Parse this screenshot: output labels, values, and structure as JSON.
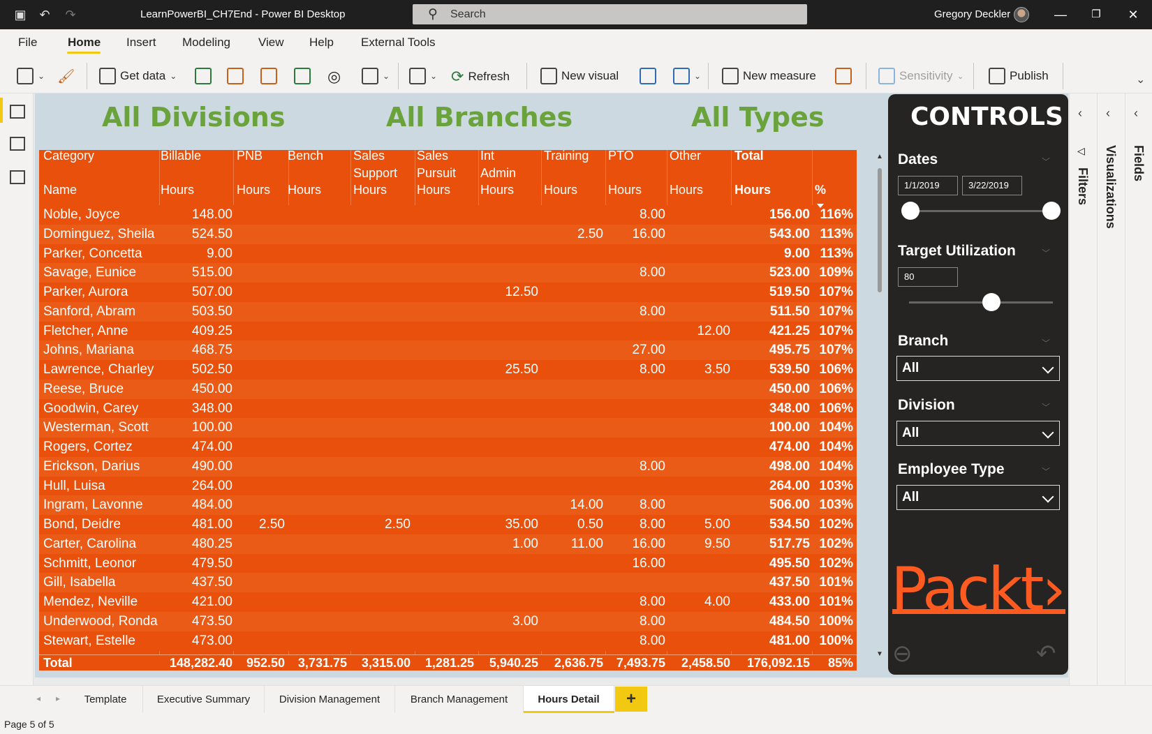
{
  "titlebar": {
    "title": "LearnPowerBI_CH7End - Power BI Desktop",
    "search_placeholder": "Search",
    "user": "Gregory Deckler"
  },
  "menu": [
    "File",
    "Home",
    "Insert",
    "Modeling",
    "View",
    "Help",
    "External Tools"
  ],
  "ribbon": {
    "get_data": "Get data",
    "refresh": "Refresh",
    "new_visual": "New visual",
    "new_measure": "New measure",
    "sensitivity": "Sensitivity",
    "publish": "Publish"
  },
  "titles": {
    "divisions": "All Divisions",
    "branches": "All Branches",
    "types": "All Types"
  },
  "table": {
    "header_top": [
      "Category",
      "Billable",
      "PNB",
      "Bench",
      "Sales\nSupport",
      "Sales\nPursuit",
      "Int\nAdmin",
      "Training",
      "PTO",
      "Other",
      "Total",
      ""
    ],
    "header_bottom": [
      "Name",
      "Hours",
      "Hours",
      "Hours",
      "Hours",
      "Hours",
      "Hours",
      "Hours",
      "Hours",
      "Hours",
      "Hours",
      "%"
    ],
    "rows": [
      [
        "Noble, Joyce",
        "148.00",
        "",
        "",
        "",
        "",
        "",
        "",
        "8.00",
        "",
        "156.00",
        "116%"
      ],
      [
        "Dominguez, Sheila",
        "524.50",
        "",
        "",
        "",
        "",
        "",
        "2.50",
        "16.00",
        "",
        "543.00",
        "113%"
      ],
      [
        "Parker, Concetta",
        "9.00",
        "",
        "",
        "",
        "",
        "",
        "",
        "",
        "",
        "9.00",
        "113%"
      ],
      [
        "Savage, Eunice",
        "515.00",
        "",
        "",
        "",
        "",
        "",
        "",
        "8.00",
        "",
        "523.00",
        "109%"
      ],
      [
        "Parker, Aurora",
        "507.00",
        "",
        "",
        "",
        "",
        "12.50",
        "",
        "",
        "",
        "519.50",
        "107%"
      ],
      [
        "Sanford, Abram",
        "503.50",
        "",
        "",
        "",
        "",
        "",
        "",
        "8.00",
        "",
        "511.50",
        "107%"
      ],
      [
        "Fletcher, Anne",
        "409.25",
        "",
        "",
        "",
        "",
        "",
        "",
        "",
        "12.00",
        "421.25",
        "107%"
      ],
      [
        "Johns, Mariana",
        "468.75",
        "",
        "",
        "",
        "",
        "",
        "",
        "27.00",
        "",
        "495.75",
        "107%"
      ],
      [
        "Lawrence, Charley",
        "502.50",
        "",
        "",
        "",
        "",
        "25.50",
        "",
        "8.00",
        "3.50",
        "539.50",
        "106%"
      ],
      [
        "Reese, Bruce",
        "450.00",
        "",
        "",
        "",
        "",
        "",
        "",
        "",
        "",
        "450.00",
        "106%"
      ],
      [
        "Goodwin, Carey",
        "348.00",
        "",
        "",
        "",
        "",
        "",
        "",
        "",
        "",
        "348.00",
        "106%"
      ],
      [
        "Westerman, Scott",
        "100.00",
        "",
        "",
        "",
        "",
        "",
        "",
        "",
        "",
        "100.00",
        "104%"
      ],
      [
        "Rogers, Cortez",
        "474.00",
        "",
        "",
        "",
        "",
        "",
        "",
        "",
        "",
        "474.00",
        "104%"
      ],
      [
        "Erickson, Darius",
        "490.00",
        "",
        "",
        "",
        "",
        "",
        "",
        "8.00",
        "",
        "498.00",
        "104%"
      ],
      [
        "Hull, Luisa",
        "264.00",
        "",
        "",
        "",
        "",
        "",
        "",
        "",
        "",
        "264.00",
        "103%"
      ],
      [
        "Ingram, Lavonne",
        "484.00",
        "",
        "",
        "",
        "",
        "",
        "14.00",
        "8.00",
        "",
        "506.00",
        "103%"
      ],
      [
        "Bond, Deidre",
        "481.00",
        "2.50",
        "",
        "2.50",
        "",
        "35.00",
        "0.50",
        "8.00",
        "5.00",
        "534.50",
        "102%"
      ],
      [
        "Carter, Carolina",
        "480.25",
        "",
        "",
        "",
        "",
        "1.00",
        "11.00",
        "16.00",
        "9.50",
        "517.75",
        "102%"
      ],
      [
        "Schmitt, Leonor",
        "479.50",
        "",
        "",
        "",
        "",
        "",
        "",
        "16.00",
        "",
        "495.50",
        "102%"
      ],
      [
        "Gill, Isabella",
        "437.50",
        "",
        "",
        "",
        "",
        "",
        "",
        "",
        "",
        "437.50",
        "101%"
      ],
      [
        "Mendez, Neville",
        "421.00",
        "",
        "",
        "",
        "",
        "",
        "",
        "8.00",
        "4.00",
        "433.00",
        "101%"
      ],
      [
        "Underwood, Ronda",
        "473.50",
        "",
        "",
        "",
        "",
        "3.00",
        "",
        "8.00",
        "",
        "484.50",
        "100%"
      ],
      [
        "Stewart, Estelle",
        "473.00",
        "",
        "",
        "",
        "",
        "",
        "",
        "8.00",
        "",
        "481.00",
        "100%"
      ]
    ],
    "total": [
      "Total",
      "148,282.40",
      "952.50",
      "3,731.75",
      "3,315.00",
      "1,281.25",
      "5,940.25",
      "2,636.75",
      "7,493.75",
      "2,458.50",
      "176,092.15",
      "85%"
    ]
  },
  "controls": {
    "title": "CONTROLS",
    "dates_label": "Dates",
    "date_start": "1/1/2019",
    "date_end": "3/22/2019",
    "target_label": "Target Utilization",
    "target_value": "80",
    "branch_label": "Branch",
    "branch_value": "All",
    "division_label": "Division",
    "division_value": "All",
    "emptype_label": "Employee Type",
    "emptype_value": "All",
    "logo": "Packt›"
  },
  "side_panes": {
    "filters": "Filters",
    "visualizations": "Visualizations",
    "fields": "Fields"
  },
  "page_tabs": [
    "Template",
    "Executive Summary",
    "Division Management",
    "Branch Management",
    "Hours Detail"
  ],
  "active_tab": "Hours Detail",
  "status": "Page 5 of 5",
  "colors": {
    "table_bg": "#e8500c",
    "title_green": "#6aa33b",
    "accent_yellow": "#f2c811",
    "controls_bg": "#252423",
    "packt_orange": "#ff5a1f"
  }
}
